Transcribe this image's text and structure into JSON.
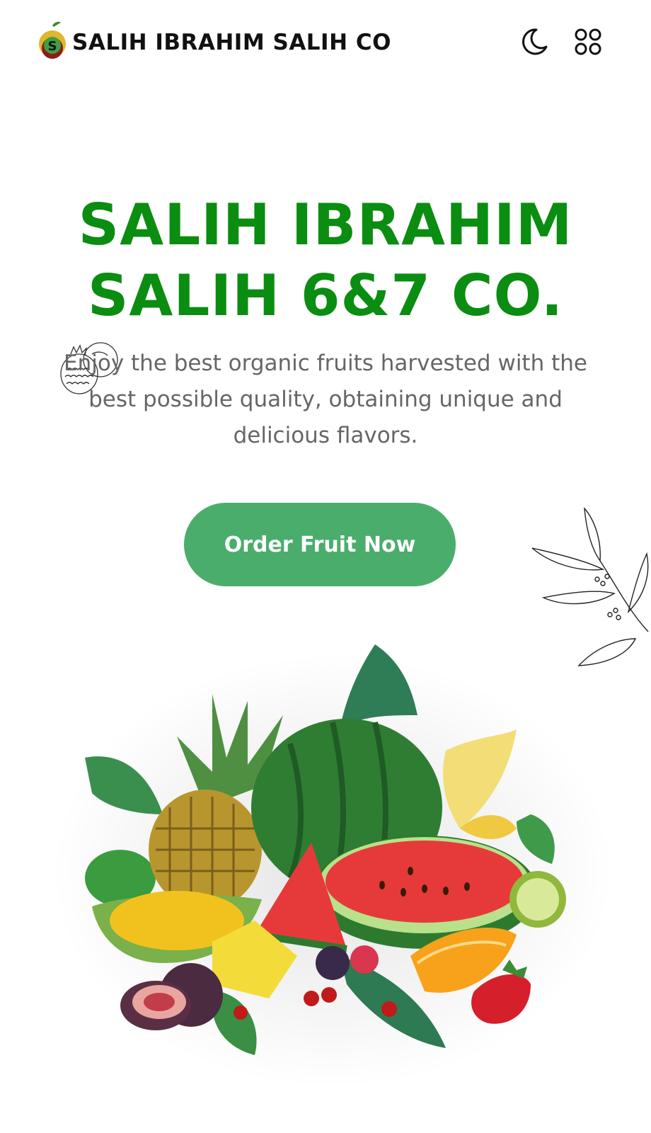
{
  "header": {
    "brand_name": "SALIH IBRAHIM SALIH CO",
    "logo_letter": "S",
    "icons": {
      "theme_toggle": "moon-icon",
      "menu": "apps-grid-icon"
    }
  },
  "hero": {
    "title_line_1": "SALIH IBRAHIM",
    "title_line_2": "SALIH 6&7 CO.",
    "description": "Enjoy the best organic fruits harvested with the best possible quality, obtaining unique and delicious flavors.",
    "cta_label": "Order Fruit Now"
  },
  "colors": {
    "title_green": "#0a8d10",
    "cta_green": "#4aad6c",
    "text_gray": "#666666",
    "background": "#ffffff"
  }
}
